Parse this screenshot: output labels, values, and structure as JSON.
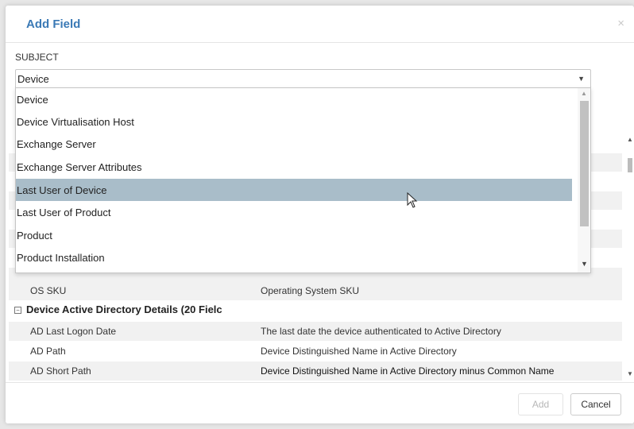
{
  "dialog": {
    "title": "Add Field",
    "close": "×"
  },
  "subject": {
    "label": "SUBJECT",
    "selected": "Device",
    "options": [
      "Device",
      "Device Virtualisation Host",
      "Exchange Server",
      "Exchange Server Attributes",
      "Last User of Device",
      "Last User of Product",
      "Product",
      "Product Installation"
    ],
    "highlighted_index": 4
  },
  "fields": {
    "rows_top": [
      {
        "name": "OS SKU",
        "description": "Operating System SKU"
      }
    ],
    "group": {
      "toggle": "−",
      "title": "Device Active Directory Details (20 Fielc"
    },
    "rows": [
      {
        "name": "AD Last Logon Date",
        "description": "The last date the device authenticated to Active Directory"
      },
      {
        "name": "AD Path",
        "description": "Device Distinguished Name in Active Directory"
      },
      {
        "name": "AD Short Path",
        "description": "Device Distinguished Name in Active Directory minus Common Name"
      }
    ]
  },
  "footer": {
    "add": "Add",
    "cancel": "Cancel"
  },
  "colors": {
    "accent": "#3a79b5",
    "highlight": "#a9bdc9",
    "stripe": "#f1f1f1"
  }
}
